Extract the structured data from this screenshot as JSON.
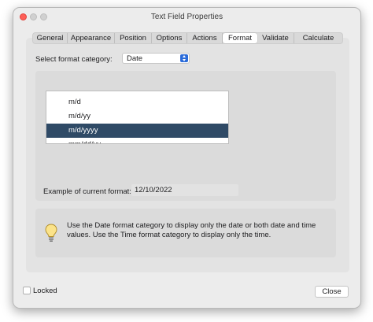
{
  "window": {
    "title": "Text Field Properties"
  },
  "tabs": [
    {
      "label": "General"
    },
    {
      "label": "Appearance"
    },
    {
      "label": "Position"
    },
    {
      "label": "Options"
    },
    {
      "label": "Actions"
    },
    {
      "label": "Format",
      "active": true
    },
    {
      "label": "Validate"
    },
    {
      "label": "Calculate"
    }
  ],
  "format": {
    "category_label": "Select format category:",
    "category_value": "Date",
    "options": [
      "m/d",
      "m/d/yy",
      "m/d/yyyy",
      "mm/dd/yy"
    ],
    "selected_option": "m/d/yyyy",
    "example_label": "Example of current format:",
    "example_value": "12/10/2022"
  },
  "info": {
    "text": "Use the Date format category to display only the date or both date and time values. Use the Time format category to display only the time.",
    "icon": "lightbulb-icon"
  },
  "footer": {
    "locked_label": "Locked",
    "locked_checked": false,
    "close_label": "Close"
  },
  "colors": {
    "selection": "#2f4a66",
    "accent": "#2a6bd9",
    "close_traffic": "#fe5f57"
  }
}
